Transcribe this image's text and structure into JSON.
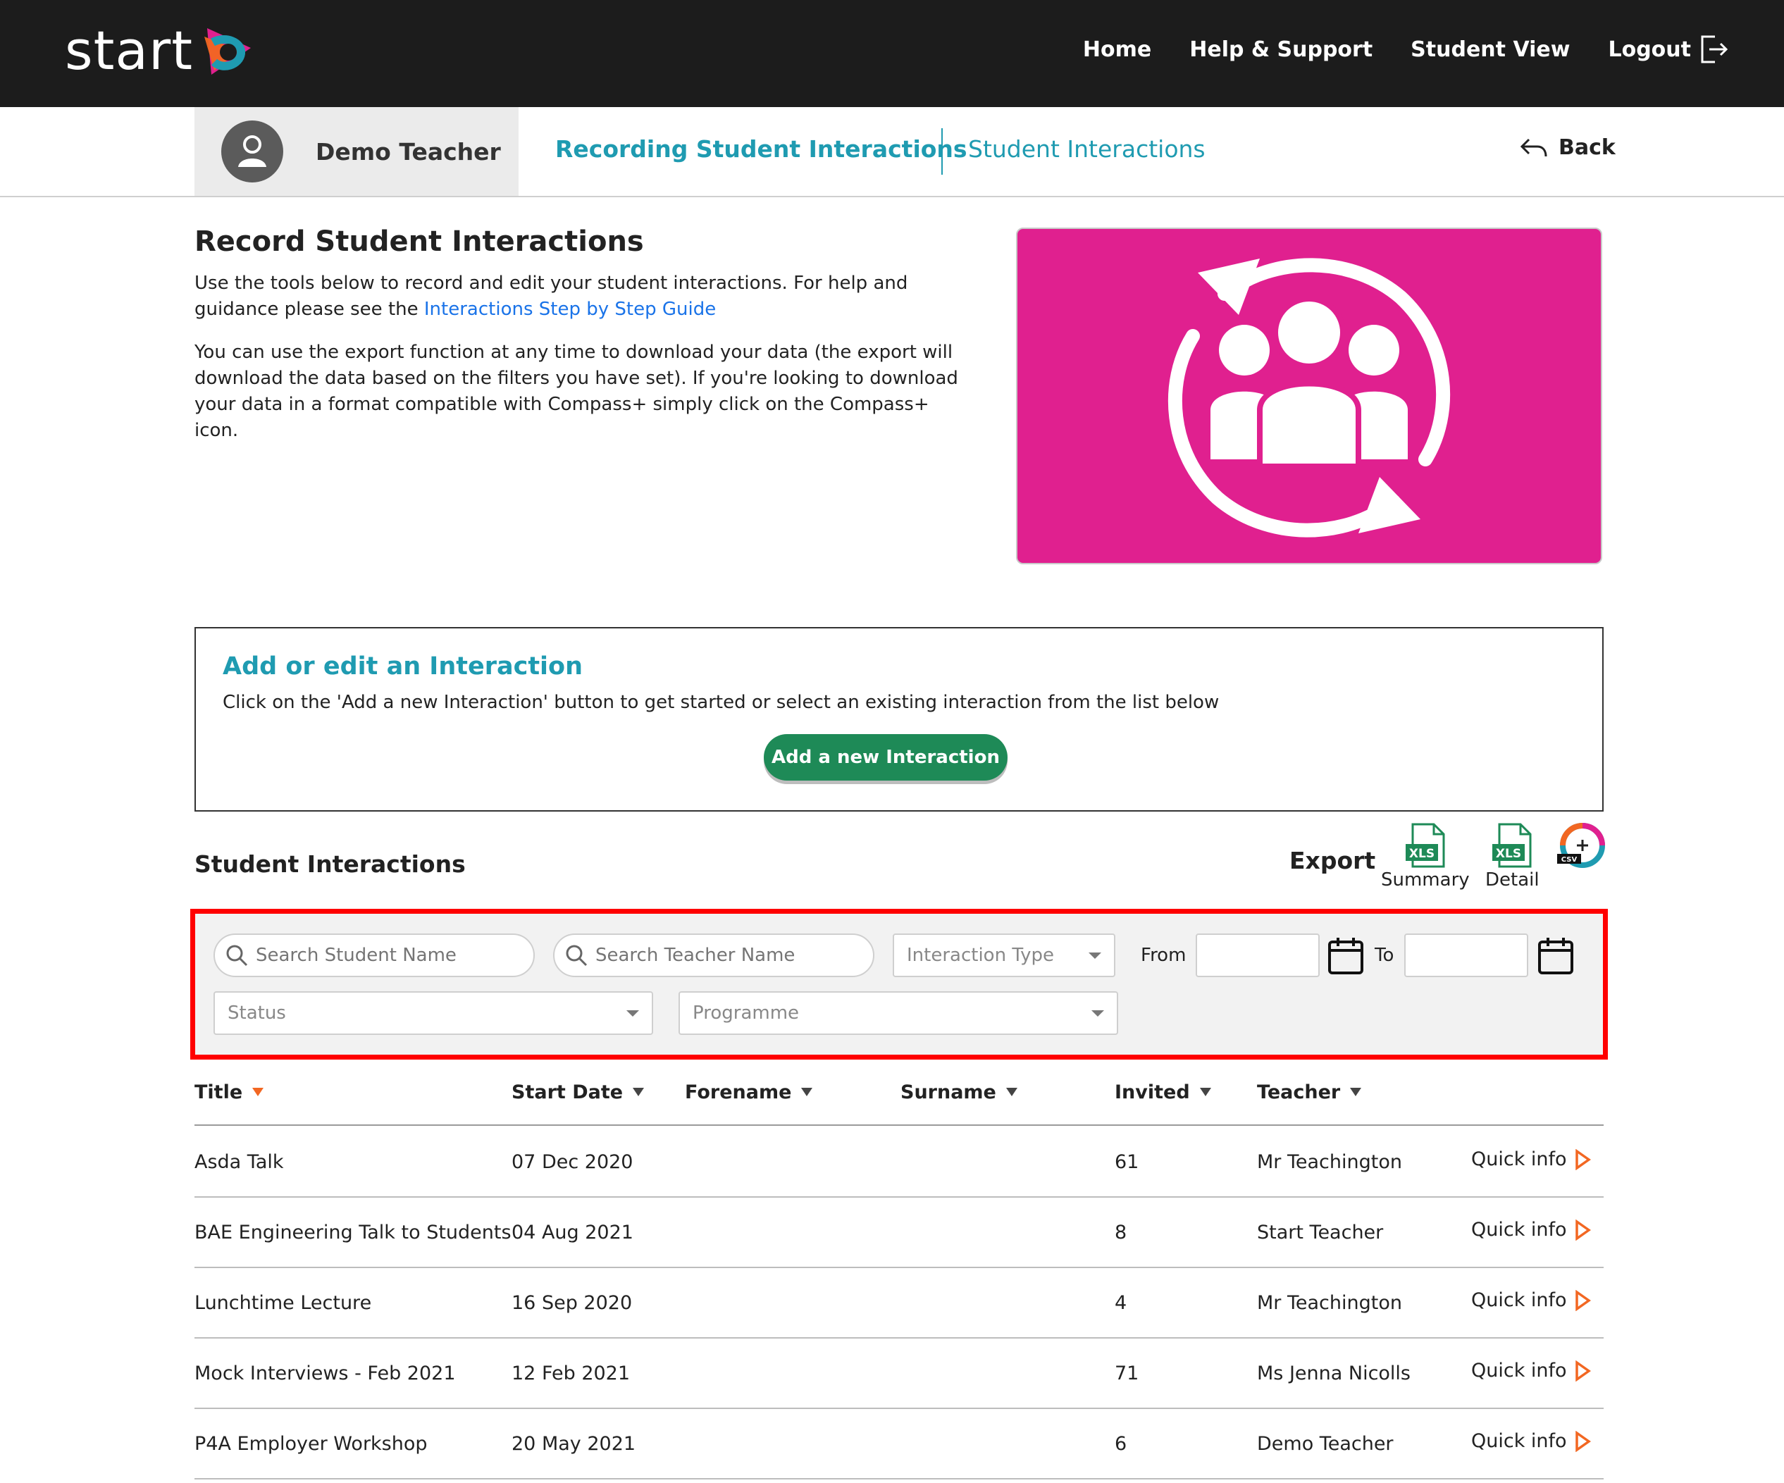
{
  "header": {
    "logo_text": "start",
    "nav": [
      {
        "label": "Home"
      },
      {
        "label": "Help & Support"
      },
      {
        "label": "Student View"
      },
      {
        "label": "Logout"
      }
    ]
  },
  "subheader": {
    "teacher_name": "Demo Teacher",
    "active_tab": "Recording Student Interactions",
    "other_tab": "Student Interactions",
    "back_label": "Back"
  },
  "intro": {
    "title": "Record Student Interactions",
    "p1_text": "Use the tools below to record and edit your student interactions. For help and guidance please see the ",
    "p1_link": "Interactions Step by Step Guide",
    "p2": "You can use the export function at any time to download your data (the export will download the data based on the filters you have set). If you're looking to download your data in a format compatible with Compass+ simply click on the Compass+ icon."
  },
  "add_panel": {
    "title": "Add or edit an Interaction",
    "description": "Click on the 'Add a new Interaction' button to get started or select an existing interaction from the list below",
    "button_label": "Add a new Interaction"
  },
  "interactions": {
    "title": "Student Interactions",
    "export_label": "Export",
    "export_summary": "Summary",
    "export_detail": "Detail",
    "xls_badge": "XLS",
    "csv_badge": "CSV"
  },
  "filters": {
    "student_placeholder": "Search Student Name",
    "teacher_placeholder": "Search Teacher Name",
    "interaction_type": "Interaction Type",
    "from_label": "From",
    "to_label": "To",
    "status": "Status",
    "programme": "Programme"
  },
  "table": {
    "columns": {
      "title": "Title",
      "start_date": "Start Date",
      "forename": "Forename",
      "surname": "Surname",
      "invited": "Invited",
      "teacher": "Teacher"
    },
    "quick_info_label": "Quick info",
    "rows": [
      {
        "title": "Asda Talk",
        "start_date": "07 Dec 2020",
        "forename": "",
        "surname": "",
        "invited": "61",
        "teacher": "Mr Teachington"
      },
      {
        "title": "BAE Engineering Talk to Students",
        "start_date": "04 Aug 2021",
        "forename": "",
        "surname": "",
        "invited": "8",
        "teacher": "Start Teacher"
      },
      {
        "title": "Lunchtime Lecture",
        "start_date": "16 Sep 2020",
        "forename": "",
        "surname": "",
        "invited": "4",
        "teacher": "Mr Teachington"
      },
      {
        "title": "Mock Interviews - Feb 2021",
        "start_date": "12 Feb 2021",
        "forename": "",
        "surname": "",
        "invited": "71",
        "teacher": "Ms Jenna Nicolls"
      },
      {
        "title": "P4A Employer Workshop",
        "start_date": "20 May 2021",
        "forename": "",
        "surname": "",
        "invited": "6",
        "teacher": "Demo Teacher"
      }
    ]
  },
  "colors": {
    "topbar": "#1c1c1c",
    "accent_teal": "#1f9bb1",
    "hero_pink": "#e0208f",
    "button_green": "#1e8a57",
    "highlight_red": "#ff0000",
    "sort_orange": "#f26722"
  }
}
